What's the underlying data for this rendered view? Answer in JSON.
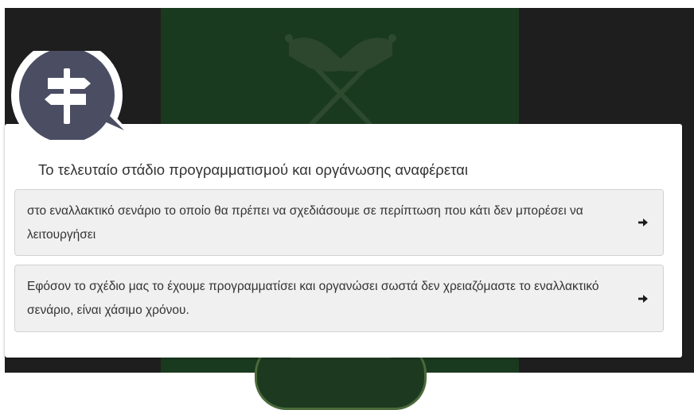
{
  "quiz": {
    "question": "Το τελευταίο στάδιο προγραμματισμού και οργάνωσης αναφέρεται",
    "options": [
      {
        "text": "στο εναλλακτικό σενάριο το οποίο θα πρέπει να σχεδιάσουμε σε περίπτωση που κάτι δεν μπορέσει να λειτουργήσει"
      },
      {
        "text": "Εφόσον το σχέδιο μας το έχουμε προγραμματίσει και οργανώσει σωστά δεν χρειαζόμαστε το εναλλακτικό σενάριο, είναι χάσιμο χρόνου."
      }
    ]
  },
  "icons": {
    "speech": "signpost-speech-bubble-icon",
    "next": "arrow-right-icon",
    "background": "crossed-flags-icon"
  },
  "colors": {
    "bubble": "#4b4d63",
    "background_panel": "#1a3a1f",
    "backdrop": "#1e1e1e",
    "option_bg": "#f0f0f0",
    "text": "#333333"
  }
}
